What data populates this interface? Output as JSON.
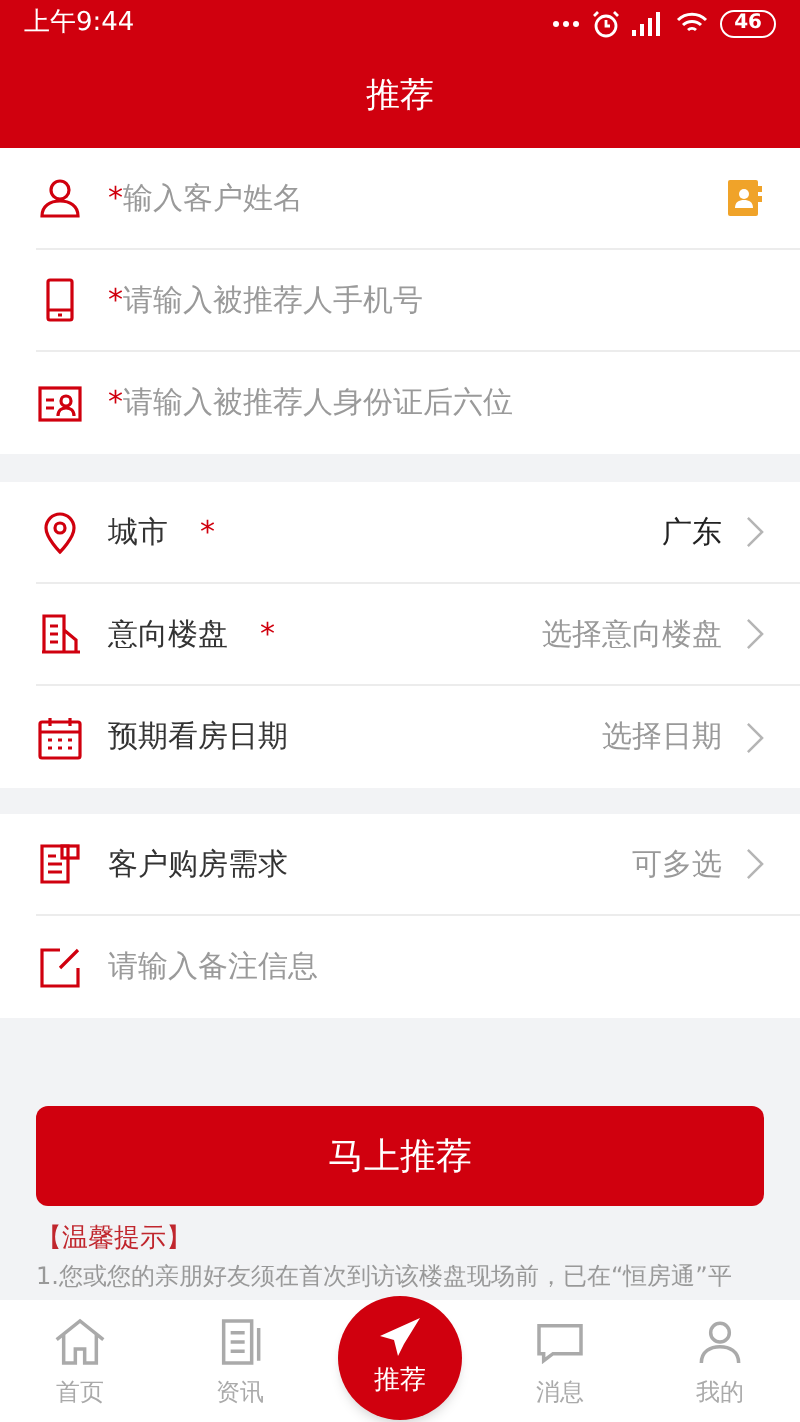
{
  "status_bar": {
    "time": "上午9:44",
    "battery": "46"
  },
  "header": {
    "title": "推荐"
  },
  "client_fields": [
    {
      "required_mark": "*",
      "placeholder": "输入客户姓名"
    },
    {
      "required_mark": "*",
      "placeholder": "请输入被推荐人手机号"
    },
    {
      "required_mark": "*",
      "placeholder": "请输入被推荐人身份证后六位"
    }
  ],
  "property_rows": [
    {
      "label": "城市",
      "required_mark": "*",
      "value": "广东"
    },
    {
      "label": "意向楼盘",
      "required_mark": "*",
      "placeholder": "选择意向楼盘"
    },
    {
      "label": "预期看房日期",
      "placeholder": "选择日期"
    }
  ],
  "demand_row": {
    "label": "客户购房需求",
    "placeholder": "可多选"
  },
  "note_field": {
    "placeholder": "请输入备注信息"
  },
  "submit_button": "马上推荐",
  "tips": {
    "title": "【温馨提示】",
    "lines": [
      "1.您或您的亲朋好友须在首次到访该楼盘现场前，已在“恒房通”平"
    ]
  },
  "tab_bar": [
    {
      "label": "首页",
      "kind": "normal",
      "selected": false
    },
    {
      "label": "资讯",
      "kind": "normal",
      "selected": false
    },
    {
      "label": "推荐",
      "kind": "center",
      "selected": true
    },
    {
      "label": "消息",
      "kind": "normal",
      "selected": false
    },
    {
      "label": "我的",
      "kind": "normal",
      "selected": false
    }
  ]
}
